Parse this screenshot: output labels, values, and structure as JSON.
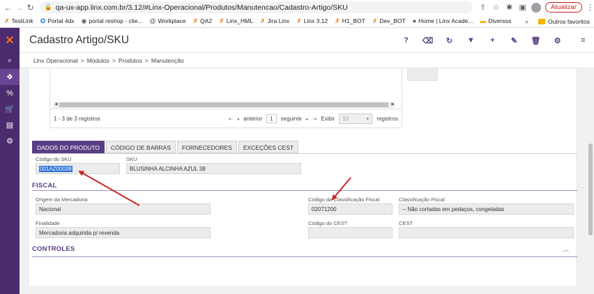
{
  "browser": {
    "url": "qa-ux-app.linx.com.br/3.12/#Linx-Operacional/Produtos/Manutencao/Cadastro-Artigo/SKU",
    "update_label": "Atualizar",
    "bookmarks": [
      {
        "label": "TestLink",
        "icon": "linx-x-icon"
      },
      {
        "label": "Portal 4dx",
        "icon": "swirl-icon"
      },
      {
        "label": "portal reshop - clie...",
        "icon": "cart-icon"
      },
      {
        "label": "Workplace",
        "icon": "at-icon"
      },
      {
        "label": "QA2",
        "icon": "linx-x-icon"
      },
      {
        "label": "Linx_HML",
        "icon": "linx-x-icon"
      },
      {
        "label": "Jira Linx",
        "icon": "linx-x-icon"
      },
      {
        "label": "Linx 3.12",
        "icon": "linx-x-icon"
      },
      {
        "label": "H1_BOT",
        "icon": "linx-x-icon"
      },
      {
        "label": "Dev_BOT",
        "icon": "linx-x-icon"
      },
      {
        "label": "Home | Linx Acade...",
        "icon": "globe-icon"
      },
      {
        "label": "Diversos",
        "icon": "folder-icon"
      }
    ],
    "more_label": "»",
    "other_favorites": "Outros favoritos"
  },
  "app": {
    "title": "Cadastro Artigo/SKU",
    "toolbar": [
      "help",
      "eraser",
      "refresh",
      "filter",
      "add",
      "edit",
      "delete",
      "settings",
      "menu"
    ]
  },
  "breadcrumb": [
    "Linx Operacional",
    "Módulos",
    "Produtos",
    "Manutenção"
  ],
  "grid": {
    "records_label": "1 - 3 de 3 registros",
    "prev_label": "anterior",
    "page": "1",
    "next_label": "seguinte",
    "show_label": "Exibir",
    "page_size": "10",
    "records_suffix": "registros"
  },
  "tabs": [
    {
      "label": "DADOS DO PRODUTO",
      "active": true
    },
    {
      "label": "CÓDIGO DE BARRAS",
      "active": false
    },
    {
      "label": "FORNECEDORES",
      "active": false
    },
    {
      "label": "EXCEÇÕES CEST",
      "active": false
    }
  ],
  "fields": {
    "sku_code_label": "Código do SKU",
    "sku_code_value": "001AZ00038",
    "sku_label": "SKU",
    "sku_value": "BLUSINHA ALCINHA AZUL 38"
  },
  "fiscal": {
    "title": "FISCAL",
    "origem_label": "Origem da Mercadoria",
    "origem_value": "Nacional",
    "finalidade_label": "Finalidade",
    "finalidade_value": "Mercadoria adquirida p/ revenda",
    "cod_class_label": "Código da Classificação Fiscal",
    "cod_class_value": "02071200",
    "class_label": "Classificação Fiscal",
    "class_value": "-- Não cortadas em pedaços, congeladas",
    "cest_code_label": "Código do CEST",
    "cest_code_value": "",
    "cest_label": "CEST",
    "cest_value": ""
  },
  "controles": {
    "title": "CONTROLES"
  },
  "colors": {
    "brand_purple": "#5a3e85",
    "rail_purple": "#4b2b6e",
    "linx_orange": "#f26b21",
    "annotation_red": "#cc2222"
  }
}
